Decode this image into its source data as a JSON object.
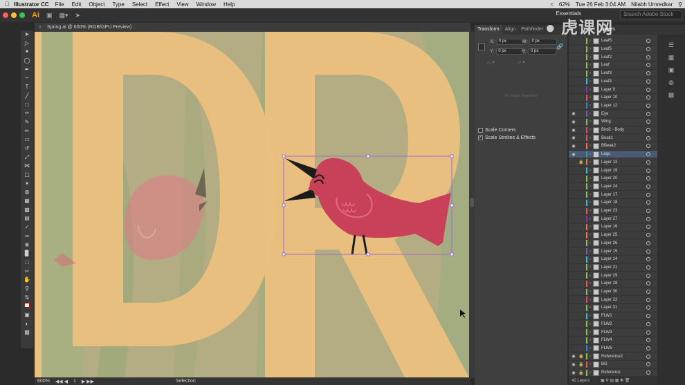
{
  "menubar": {
    "app_name": "Illustrator CC",
    "items": [
      "File",
      "Edit",
      "Object",
      "Type",
      "Select",
      "Effect",
      "View",
      "Window",
      "Help"
    ],
    "battery": "62%",
    "datetime": "Tue 26 Feb  3:04 AM",
    "user": "Nilabh Umredkar"
  },
  "appbar": {
    "logo": "Ai",
    "workspace": "Essentials",
    "search_placeholder": "Search Adobe Stock"
  },
  "document": {
    "tab_title": "Spring.ai @ 600% (RGB/GPU Preview)",
    "zoom": "600%",
    "artboard": "1",
    "status_tool": "Selection"
  },
  "transform": {
    "tabs": [
      "Transform",
      "Align",
      "Pathfinder"
    ],
    "x_label": "X:",
    "x_value": "0 px",
    "y_label": "Y:",
    "y_value": "0 px",
    "w_label": "W:",
    "w_value": "0 px",
    "h_label": "H:",
    "h_value": "0 px",
    "no_shape": "No Shape Properties",
    "scale_corners": "Scale Corners",
    "scale_strokes": "Scale Strokes & Effects",
    "scale_corners_checked": false,
    "scale_strokes_checked": true
  },
  "layers": {
    "title": "Layers",
    "count": "42 Layers",
    "rows": [
      {
        "name": "Leaf6",
        "color": "#8bc34a",
        "eye": false,
        "lock": false
      },
      {
        "name": "Leaf5",
        "color": "#8bc34a",
        "eye": false,
        "lock": false
      },
      {
        "name": "Leaf2",
        "color": "#8bc34a",
        "eye": false,
        "lock": false
      },
      {
        "name": "Leaf",
        "color": "#8bc34a",
        "eye": false,
        "lock": false
      },
      {
        "name": "Leaf3",
        "color": "#8bc34a",
        "eye": false,
        "lock": false
      },
      {
        "name": "Leaf4",
        "color": "#26c6da",
        "eye": false,
        "lock": false
      },
      {
        "name": "Layer 9",
        "color": "#9c27b0",
        "eye": false,
        "lock": false
      },
      {
        "name": "Layer 10",
        "color": "#ef5350",
        "eye": false,
        "lock": false
      },
      {
        "name": "Layer 12",
        "color": "#1e88e5",
        "eye": false,
        "lock": false
      },
      {
        "name": "Eye",
        "color": "#7e57c2",
        "eye": true,
        "lock": false
      },
      {
        "name": "Wing",
        "color": "#8bc34a",
        "eye": true,
        "lock": false
      },
      {
        "name": "Bird2 - Body",
        "color": "#ec407a",
        "eye": true,
        "lock": false
      },
      {
        "name": "Beak1",
        "color": "#ef5350",
        "eye": true,
        "lock": false
      },
      {
        "name": "BBeak2",
        "color": "#ff7043",
        "eye": true,
        "lock": false
      },
      {
        "name": "Legs",
        "color": "#26a69a",
        "eye": true,
        "lock": false
      },
      {
        "name": "Layer 13",
        "color": "#ff7043",
        "eye": false,
        "lock": true
      },
      {
        "name": "Layer 19",
        "color": "#26c6da",
        "eye": false,
        "lock": false
      },
      {
        "name": "Layer 20",
        "color": "#8bc34a",
        "eye": false,
        "lock": false
      },
      {
        "name": "Layer 24",
        "color": "#8bc34a",
        "eye": false,
        "lock": false
      },
      {
        "name": "Layer 17",
        "color": "#8bc34a",
        "eye": false,
        "lock": false
      },
      {
        "name": "Layer 18",
        "color": "#26c6da",
        "eye": false,
        "lock": false
      },
      {
        "name": "Layer 23",
        "color": "#ef5350",
        "eye": false,
        "lock": false
      },
      {
        "name": "Layer 27",
        "color": "#9c27b0",
        "eye": false,
        "lock": false
      },
      {
        "name": "Layer 16",
        "color": "#ff7043",
        "eye": false,
        "lock": false
      },
      {
        "name": "Layer 25",
        "color": "#ff7043",
        "eye": false,
        "lock": false
      },
      {
        "name": "Layer 26",
        "color": "#8bc34a",
        "eye": false,
        "lock": false
      },
      {
        "name": "Layer 15",
        "color": "#7e57c2",
        "eye": false,
        "lock": false
      },
      {
        "name": "Layer 14",
        "color": "#26c6da",
        "eye": false,
        "lock": false
      },
      {
        "name": "Layer 21",
        "color": "#8bc34a",
        "eye": false,
        "lock": false
      },
      {
        "name": "Layer 29",
        "color": "#8bc34a",
        "eye": false,
        "lock": false
      },
      {
        "name": "Layer 28",
        "color": "#ef5350",
        "eye": false,
        "lock": false
      },
      {
        "name": "Layer 30",
        "color": "#8bc34a",
        "eye": false,
        "lock": false
      },
      {
        "name": "Layer 22",
        "color": "#ec407a",
        "eye": false,
        "lock": false
      },
      {
        "name": "Layer 31",
        "color": "#8bc34a",
        "eye": false,
        "lock": false
      },
      {
        "name": "FLW1",
        "color": "#26c6da",
        "eye": false,
        "lock": false
      },
      {
        "name": "FLW2",
        "color": "#8bc34a",
        "eye": false,
        "lock": false
      },
      {
        "name": "FLW3",
        "color": "#8bc34a",
        "eye": false,
        "lock": false
      },
      {
        "name": "FLW4",
        "color": "#8bc34a",
        "eye": false,
        "lock": false
      },
      {
        "name": "FLW5",
        "color": "#1e88e5",
        "eye": false,
        "lock": false
      },
      {
        "name": "Reference2",
        "color": "#8bc34a",
        "eye": true,
        "lock": true
      },
      {
        "name": "BG",
        "color": "#ef5350",
        "eye": true,
        "lock": true
      },
      {
        "name": "Reference",
        "color": "#8bc34a",
        "eye": true,
        "lock": true
      }
    ]
  },
  "colors": {
    "bird": "#c94158",
    "letters": "#ebc07e",
    "background": "#b4ad83",
    "selection": "#9b6bd0"
  }
}
